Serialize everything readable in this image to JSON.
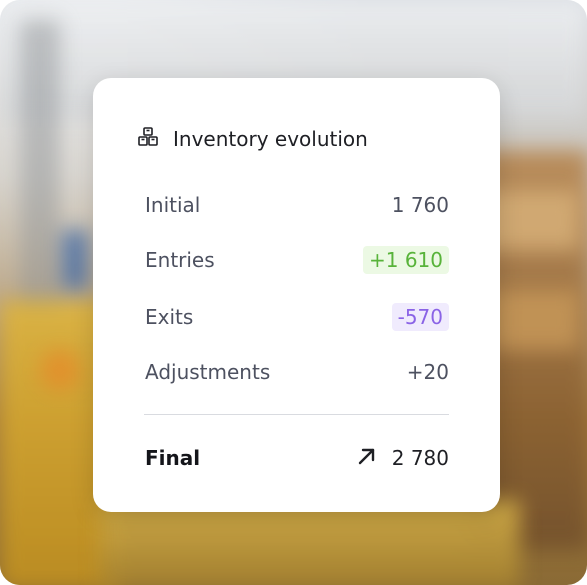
{
  "card": {
    "title": "Inventory evolution",
    "icon": "boxes-icon",
    "rows": [
      {
        "label": "Initial",
        "value": "1 760"
      },
      {
        "label": "Entries",
        "value": "+1 610"
      },
      {
        "label": "Exits",
        "value": "-570"
      },
      {
        "label": "Adjustments",
        "value": "+20"
      }
    ],
    "final": {
      "label": "Final",
      "value": "2 780",
      "icon": "arrow-up-right-icon"
    }
  },
  "colors": {
    "entries_text": "#58b33a",
    "entries_bg": "#ecf9e4",
    "exits_text": "#8a63e6",
    "exits_bg": "#f0ebfd"
  }
}
